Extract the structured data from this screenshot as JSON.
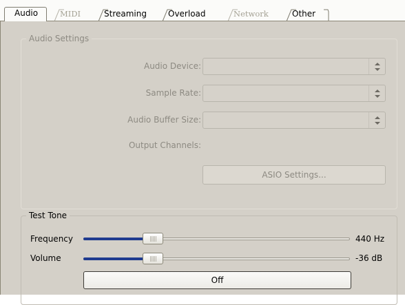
{
  "tabs": [
    {
      "label": "Audio",
      "state": "active"
    },
    {
      "label": "MIDI",
      "state": "disabled"
    },
    {
      "label": "Streaming",
      "state": "enabled"
    },
    {
      "label": "Overload",
      "state": "enabled"
    },
    {
      "label": "Network",
      "state": "disabled"
    },
    {
      "label": "Other",
      "state": "enabled"
    }
  ],
  "audio_settings": {
    "title": "Audio Settings",
    "audio_device_label": "Audio Device:",
    "audio_device_value": "",
    "sample_rate_label": "Sample Rate:",
    "sample_rate_value": "",
    "buffer_size_label": "Audio Buffer Size:",
    "buffer_size_value": "",
    "output_channels_label": "Output Channels:",
    "asio_button_label": "ASIO Settings...",
    "enabled": false
  },
  "test_tone": {
    "title": "Test Tone",
    "frequency_label": "Frequency",
    "frequency_value": "440 Hz",
    "frequency_position": 0.24,
    "volume_label": "Volume",
    "volume_value": "-36 dB",
    "volume_position": 0.24,
    "toggle_label": "Off"
  },
  "icons": {
    "combo_arrow": "updown-arrow-icon",
    "slider_grip": "grip-icon"
  },
  "colors": {
    "panel_bg": "#d4d0c8",
    "slider_fill": "#1f3b8f",
    "disabled_text": "#8d8a82"
  }
}
